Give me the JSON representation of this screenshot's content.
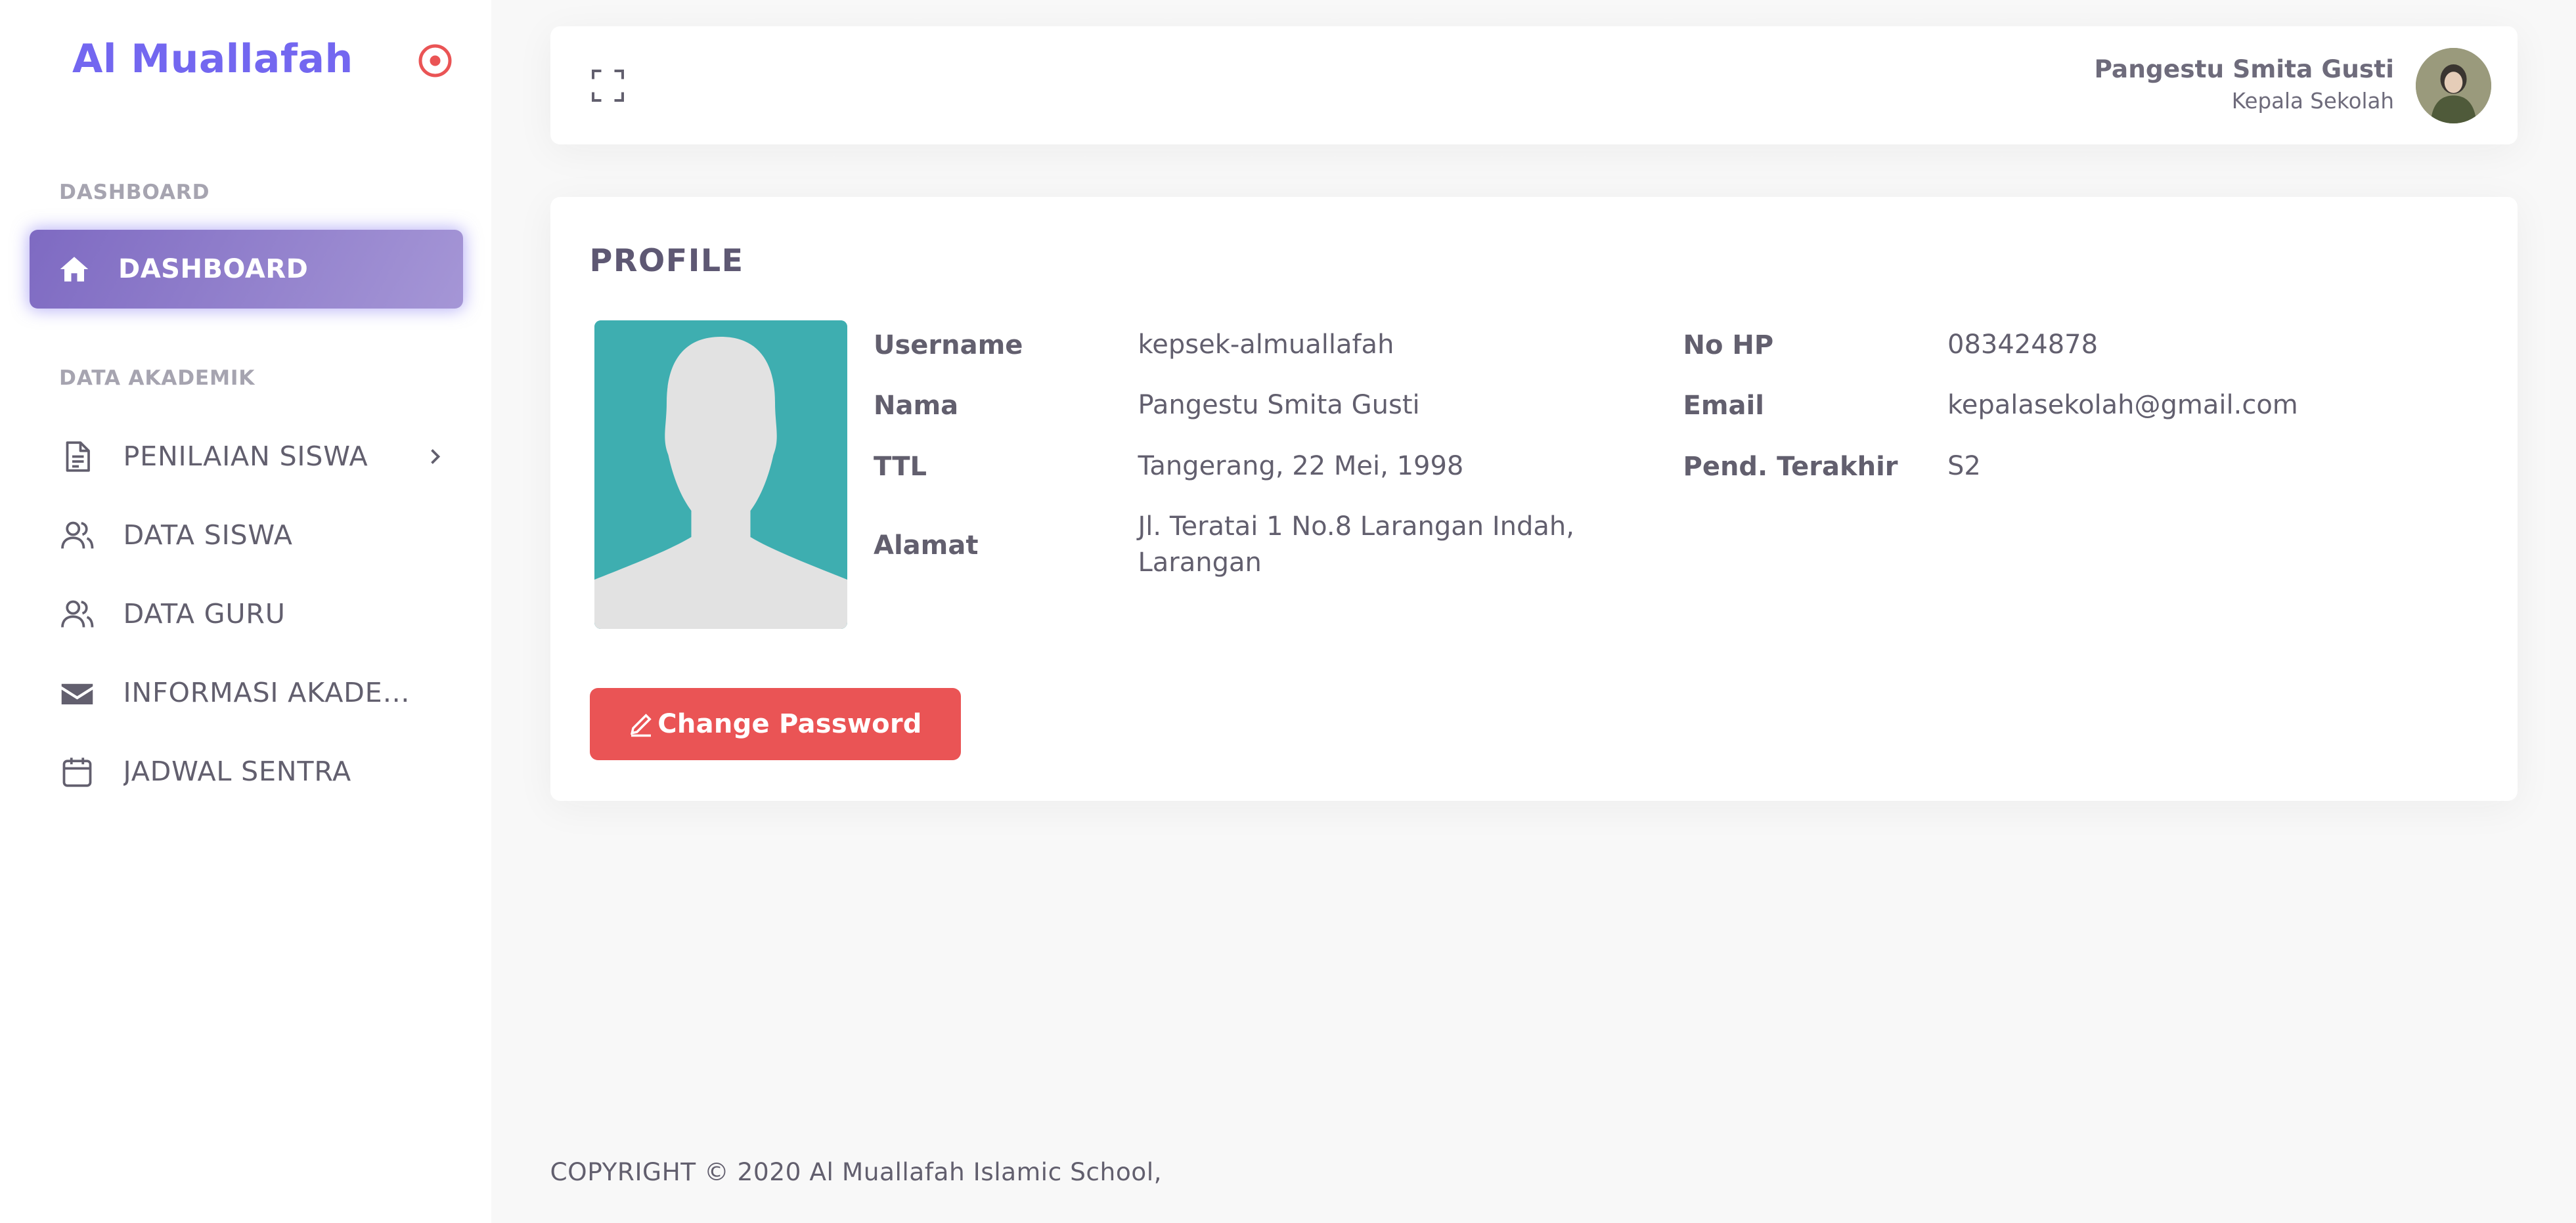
{
  "brand": {
    "name": "Al Muallafah",
    "toggle_icon": "circle-dot-icon",
    "accent": "#7367f0"
  },
  "sidebar": {
    "sections": [
      {
        "label": "DASHBOARD"
      },
      {
        "label": "DATA AKADEMIK"
      }
    ],
    "active_item": {
      "label": "DASHBOARD",
      "icon": "home-icon"
    },
    "items": [
      {
        "label": "PENILAIAN SISWA",
        "icon": "file-text-icon",
        "has_submenu": true
      },
      {
        "label": "DATA SISWA",
        "icon": "users-icon"
      },
      {
        "label": "DATA GURU",
        "icon": "users-icon"
      },
      {
        "label": "INFORMASI AKADEMIK",
        "icon": "mail-icon"
      },
      {
        "label": "JADWAL SENTRA",
        "icon": "calendar-icon"
      }
    ]
  },
  "header": {
    "fullscreen_icon": "maximize-icon",
    "user": {
      "name": "Pangestu Smita Gusti",
      "role": "Kepala Sekolah",
      "avatar": "avatar-photo"
    }
  },
  "profile": {
    "title": "PROFILE",
    "photo": "person-placeholder-image",
    "fields_left": [
      {
        "label": "Username",
        "value": "kepsek-almuallafah"
      },
      {
        "label": "Nama",
        "value": "Pangestu Smita Gusti"
      },
      {
        "label": "TTL",
        "value": "Tangerang, 22 Mei, 1998"
      },
      {
        "label": "Alamat",
        "value_line1": "Jl. Teratai 1 No.8 Larangan Indah,",
        "value_line2": "Larangan"
      }
    ],
    "fields_right": [
      {
        "label": "No HP",
        "value": "083424878"
      },
      {
        "label": "Email",
        "value": "kepalasekolah@gmail.com"
      },
      {
        "label": "Pend. Terakhir",
        "value": "S2"
      }
    ],
    "change_password": {
      "label": "Change Password",
      "icon": "edit-pen-icon",
      "color": "#ea5455"
    }
  },
  "footer": {
    "text": "COPYRIGHT © 2020 Al Muallafah Islamic School,"
  }
}
